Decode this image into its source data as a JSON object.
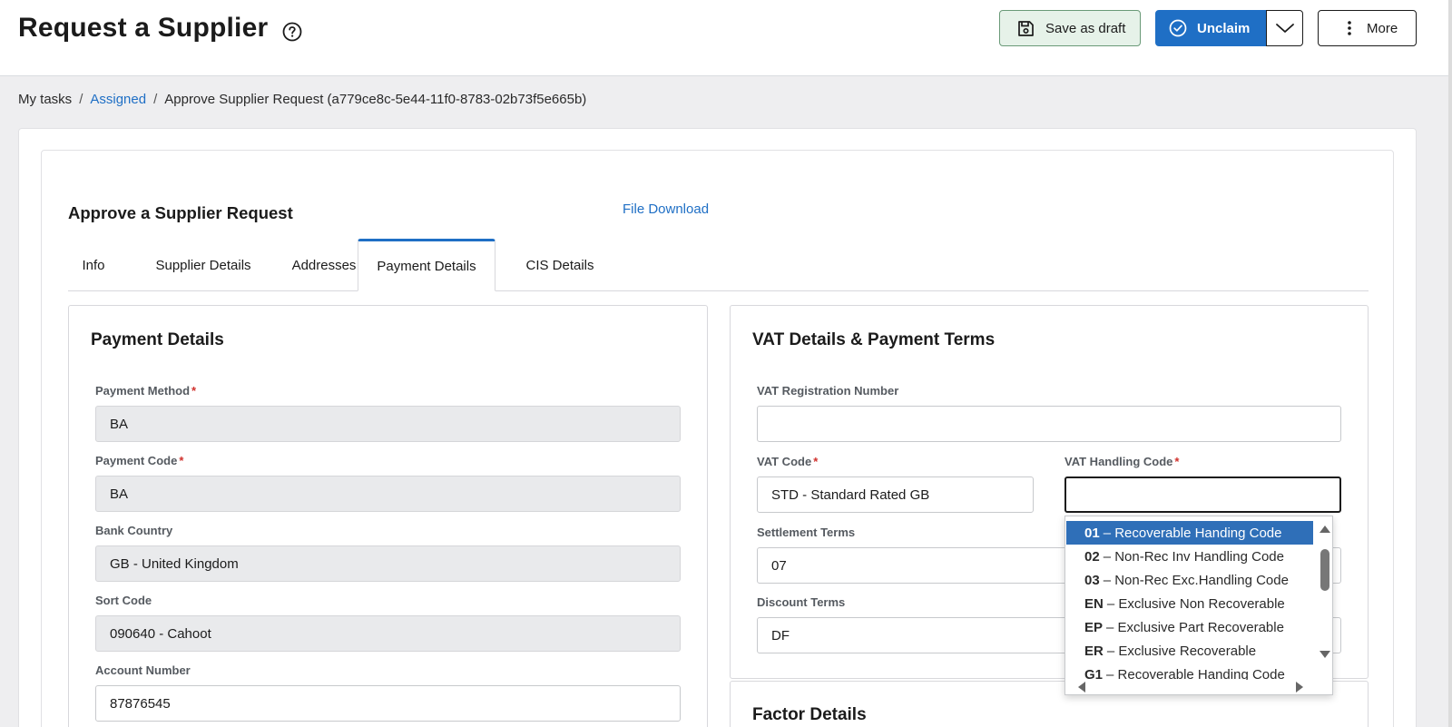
{
  "header": {
    "title": "Request a Supplier",
    "save_draft_label": "Save as draft",
    "unclaim_label": "Unclaim",
    "more_label": "More"
  },
  "breadcrumb": {
    "items": [
      "My tasks",
      "Assigned",
      "Approve Supplier Request (a779ce8c-5e44-11f0-8783-02b73f5e665b)"
    ],
    "separator": "/"
  },
  "form": {
    "title": "Approve a Supplier Request",
    "file_download_label": "File Download",
    "tabs": [
      {
        "label": "Info"
      },
      {
        "label": "Supplier Details"
      },
      {
        "label": "Addresses"
      },
      {
        "label": "Payment Details",
        "active": true
      },
      {
        "label": "CIS Details"
      }
    ]
  },
  "payment_details": {
    "title": "Payment Details",
    "fields": [
      {
        "label": "Payment Method",
        "required": true,
        "value": "BA",
        "readonly": true
      },
      {
        "label": "Payment Code",
        "required": true,
        "value": "BA",
        "readonly": true
      },
      {
        "label": "Bank Country",
        "required": false,
        "value": "GB - United Kingdom",
        "readonly": true
      },
      {
        "label": "Sort Code",
        "required": false,
        "value": "090640 - Cahoot",
        "readonly": true
      },
      {
        "label": "Account Number",
        "required": false,
        "value": "87876545",
        "readonly": false
      }
    ]
  },
  "vat_details": {
    "title": "VAT Details & Payment Terms",
    "vat_registration": {
      "label": "VAT Registration Number",
      "value": ""
    },
    "vat_code": {
      "label": "VAT Code",
      "value": "STD - Standard Rated GB"
    },
    "vat_handling_code": {
      "label": "VAT Handling Code",
      "value": ""
    },
    "settlement_terms": {
      "label": "Settlement Terms",
      "value": "07"
    },
    "discount_terms": {
      "label": "Discount Terms",
      "value": "DF"
    },
    "required_marker": "*"
  },
  "vat_handling_dropdown": {
    "options": [
      {
        "code": "01",
        "label": "– Recoverable Handing Code",
        "selected": true
      },
      {
        "code": "02",
        "label": "– Non-Rec Inv Handling Code"
      },
      {
        "code": "03",
        "label": "– Non-Rec Exc.Handling Code"
      },
      {
        "code": "EN",
        "label": "– Exclusive Non Recoverable"
      },
      {
        "code": "EP",
        "label": "– Exclusive Part Recoverable"
      },
      {
        "code": "ER",
        "label": "– Exclusive Recoverable"
      },
      {
        "code": "G1",
        "label": "– Recoverable Handing Code"
      }
    ]
  },
  "factor_details": {
    "title": "Factor Details"
  },
  "colors": {
    "accent_blue": "#1f6fc5",
    "draft_button_bg": "#e6f2e9",
    "selected_option_bg": "#2f6fb8",
    "required_red": "#d0312d"
  },
  "icons": [
    "help-circle-icon",
    "save-floppy-icon",
    "check-circle-icon",
    "chevron-down-icon",
    "more-vertical-icon"
  ]
}
